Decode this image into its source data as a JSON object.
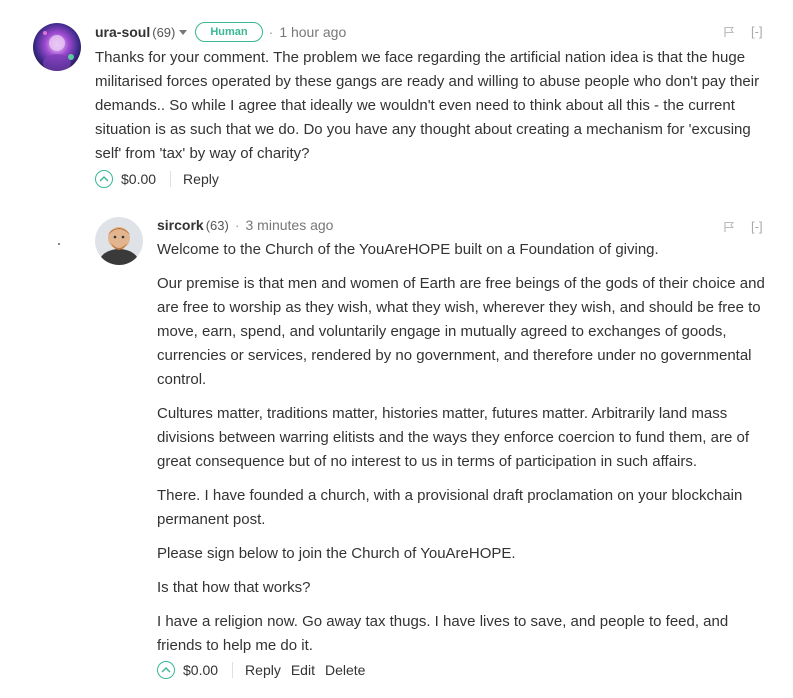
{
  "comments": [
    {
      "author": "ura-soul",
      "reputation": "(69)",
      "badge": "Human",
      "separator": "·",
      "time": "1 hour ago",
      "collapse": "[-]",
      "paragraphs": [
        "Thanks for your comment. The problem we face regarding the artificial nation idea is that the huge militarised forces operated by these gangs are ready and willing to abuse people who don't pay their demands.. So while I agree that ideally we wouldn't even need to think about all this - the current situation is as such that we do. Do you have any thought about creating a mechanism for 'excusing self' from 'tax' by way of charity?"
      ],
      "payout": "$0.00",
      "actions": [
        "Reply"
      ]
    },
    {
      "author": "sircork",
      "reputation": "(63)",
      "separator": "·",
      "time": "3 minutes ago",
      "collapse": "[-]",
      "paragraphs": [
        "Welcome to the Church of the YouAreHOPE built on a Foundation of giving.",
        "Our premise is that men and women of Earth are free beings of the gods of their choice and are free to worship as they wish, what they wish, wherever they wish, and should be free to move, earn, spend, and voluntarily engage in mutually agreed to exchanges of goods, currencies or services, rendered by no government, and therefore under no governmental control.",
        "Cultures matter, traditions matter, histories matter, futures matter. Arbitrarily land mass divisions between warring elitists and the ways they enforce coercion to fund them, are of great consequence but of no interest to us in terms of participation in such affairs.",
        "There. I have founded a church, with a provisional draft proclamation on your blockchain permanent post.",
        "Please sign below to join the Church of YouAreHOPE.",
        "Is that how that works?",
        "I have a religion now. Go away tax thugs. I have lives to save, and people to feed, and friends to help me do it."
      ],
      "payout": "$0.00",
      "actions": [
        "Reply",
        "Edit",
        "Delete"
      ]
    }
  ],
  "colors": {
    "accent": "#3ab795",
    "text": "#333333",
    "muted": "#777777"
  },
  "icons": [
    "avatar",
    "chevron-down-icon",
    "flag-icon",
    "upvote-icon"
  ]
}
